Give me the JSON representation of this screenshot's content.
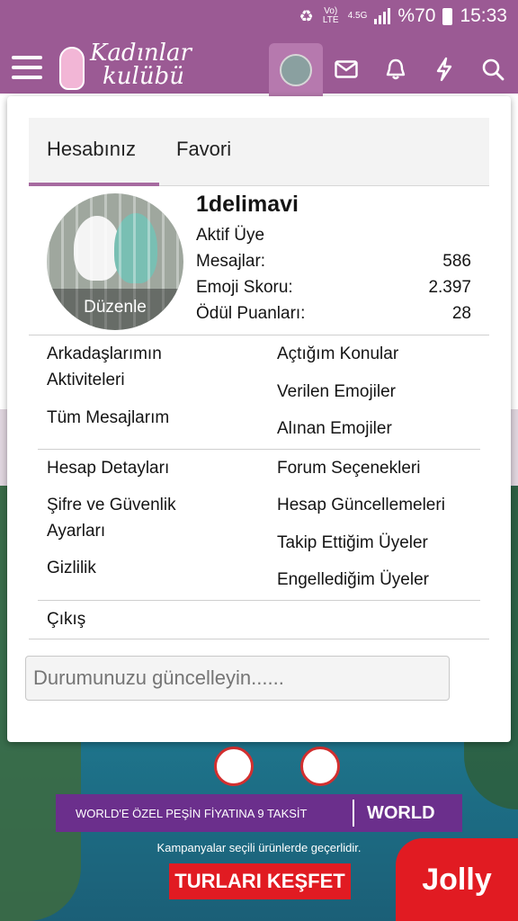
{
  "status_bar": {
    "network": "Vo) LTE",
    "network_type": "4.5G",
    "battery": "%70",
    "time": "15:33"
  },
  "header": {
    "logo_line1": "Kadınlar",
    "logo_line2": "kulübü",
    "brand_color": "#9b5a94"
  },
  "account_menu": {
    "tabs": [
      {
        "label": "Hesabınız",
        "active": true
      },
      {
        "label": "Favori",
        "active": false
      }
    ],
    "profile": {
      "avatar_action": "Düzenle",
      "username": "1delimavi",
      "role": "Aktif Üye",
      "stats": [
        {
          "label": "Mesajlar:",
          "value": "586"
        },
        {
          "label": "Emoji Skoru:",
          "value": "2.397"
        },
        {
          "label": "Ödül Puanları:",
          "value": "28"
        }
      ]
    },
    "group1_left": [
      "Arkadaşlarımın",
      "Aktiviteleri",
      "Tüm Mesajlarım"
    ],
    "group1_right": [
      "Açtığım Konular",
      "Verilen Emojiler",
      "Alınan Emojiler"
    ],
    "group2_left": [
      "Hesap Detayları",
      "Şifre ve Güvenlik",
      "Ayarları",
      "Gizlilik"
    ],
    "group2_right": [
      "Forum Seçenekleri",
      "Hesap Güncellemeleri",
      "Takip Ettiğim Üyeler",
      "Engellediğim Üyeler"
    ],
    "logout": "Çıkış",
    "status_placeholder": "Durumunuzu güncelleyin......"
  },
  "ad": {
    "band_text": "WORLD'E ÖZEL PEŞİN FİYATINA 9 TAKSİT",
    "band_brand": "WORLD",
    "subtext": "Kampanyalar seçili ürünlerde geçerlidir.",
    "button": "TURLARI KEŞFET",
    "brand": "Jolly"
  }
}
